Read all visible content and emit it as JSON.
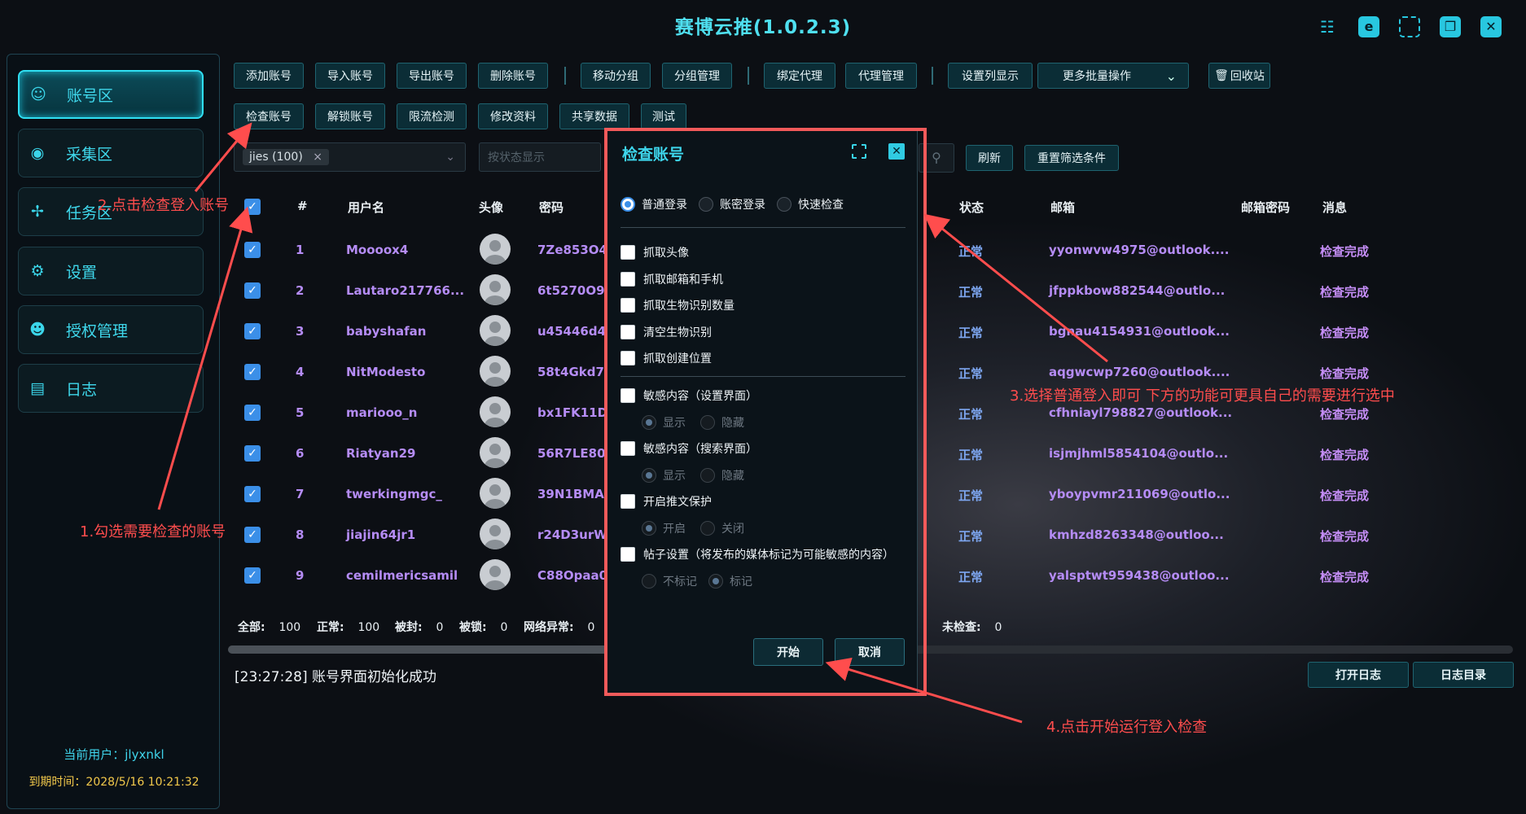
{
  "app": {
    "title": "赛博云推(1.0.2.3)"
  },
  "window_controls": [
    "db-icon",
    "skin-icon",
    "fullscreen-icon",
    "restore-icon",
    "close-icon"
  ],
  "sidebar": {
    "items": [
      {
        "label": "账号区",
        "icon": "user-icon"
      },
      {
        "label": "采集区",
        "icon": "globe-icon"
      },
      {
        "label": "任务区",
        "icon": "puzzle-icon"
      },
      {
        "label": "设置",
        "icon": "gear-icon"
      },
      {
        "label": "授权管理",
        "icon": "users-icon"
      },
      {
        "label": "日志",
        "icon": "document-icon"
      }
    ],
    "current_user": "当前用户：jlyxnkl",
    "expiry": "到期时间：2028/5/16 10:21:32"
  },
  "toolbar": {
    "row1": [
      "添加账号",
      "导入账号",
      "导出账号",
      "删除账号",
      "移动分组",
      "分组管理",
      "绑定代理",
      "代理管理",
      "设置列显示",
      "更多批量操作",
      "回收站"
    ],
    "row2": [
      "检查账号",
      "解锁账号",
      "限流检测",
      "修改资料",
      "共享数据",
      "测试"
    ]
  },
  "filters": {
    "group_tag": "jies (100)",
    "tag_close": "×",
    "status_placeholder": "按状态显示",
    "refresh": "刷新",
    "reset": "重置筛选条件"
  },
  "table": {
    "headers": {
      "index": "#",
      "username": "用户名",
      "avatar": "头像",
      "password": "密码",
      "status": "状态",
      "email": "邮箱",
      "email_password": "邮箱密码",
      "message": "消息"
    },
    "rows": [
      {
        "index": "1",
        "username": "Moooox4",
        "password": "7Ze853O4",
        "status": "正常",
        "email": "yyonwvw4975@outlook....",
        "message": "检查完成"
      },
      {
        "index": "2",
        "username": "Lautaro217766...",
        "password": "6t5270O9.",
        "status": "正常",
        "email": "jfppkbow882544@outlo...",
        "message": "检查完成"
      },
      {
        "index": "3",
        "username": "babyshafan",
        "password": "u45446d4",
        "status": "正常",
        "email": "bgnau4154931@outlook...",
        "message": "检查完成"
      },
      {
        "index": "4",
        "username": "NitModesto",
        "password": "58t4Gkd7.",
        "status": "正常",
        "email": "aqgwcwp7260@outlook....",
        "message": "检查完成"
      },
      {
        "index": "5",
        "username": "mariooo_n",
        "password": "bx1FK11D",
        "status": "正常",
        "email": "cfhniayl798827@outlook...",
        "message": "检查完成"
      },
      {
        "index": "6",
        "username": "Riatyan29",
        "password": "56R7LE80.",
        "status": "正常",
        "email": "isjmjhml5854104@outlo...",
        "message": "检查完成"
      },
      {
        "index": "7",
        "username": "twerkingmgc_",
        "password": "39N1BMA",
        "status": "正常",
        "email": "yboypvmr211069@outlo...",
        "message": "检查完成"
      },
      {
        "index": "8",
        "username": "jiajin64jr1",
        "password": "r24D3urW",
        "status": "正常",
        "email": "kmhzd8263348@outloo...",
        "message": "检查完成"
      },
      {
        "index": "9",
        "username": "cemilmericsamil",
        "password": "C88Opaa0",
        "status": "正常",
        "email": "yalsptwt959438@outloo...",
        "message": "检查完成"
      }
    ]
  },
  "stats": {
    "all_label": "全部:",
    "all": "100",
    "normal_label": "正常:",
    "normal": "100",
    "banned_label": "被封:",
    "banned": "0",
    "locked_label": "被锁:",
    "locked": "0",
    "network_label": "网络异常:",
    "network": "0",
    "unchecked_label": "未检查:",
    "unchecked": "0"
  },
  "log": {
    "line": "[23:27:28] 账号界面初始化成功",
    "open_log": "打开日志",
    "log_dir": "日志目录"
  },
  "dialog": {
    "title": "检查账号",
    "login_modes": [
      "普通登录",
      "账密登录",
      "快速检查"
    ],
    "options": [
      "抓取头像",
      "抓取邮箱和手机",
      "抓取生物识别数量",
      "清空生物识别",
      "抓取创建位置"
    ],
    "sensitive_settings": "敏感内容（设置界面）",
    "sensitive_search": "敏感内容（搜索界面）",
    "show": "显示",
    "hide": "隐藏",
    "protect": "开启推文保护",
    "on": "开启",
    "off": "关闭",
    "post_settings": "帖子设置（将发布的媒体标记为可能敏感的内容）",
    "no_mark": "不标记",
    "mark": "标记",
    "start": "开始",
    "cancel": "取消"
  },
  "annotations": {
    "a1": "1.勾选需要检查的账号",
    "a2": "2.点击检查登入账号",
    "a3": "3.选择普通登入即可 下方的功能可更具自己的需要进行选中",
    "a4": "4.点击开始运行登入检查"
  }
}
